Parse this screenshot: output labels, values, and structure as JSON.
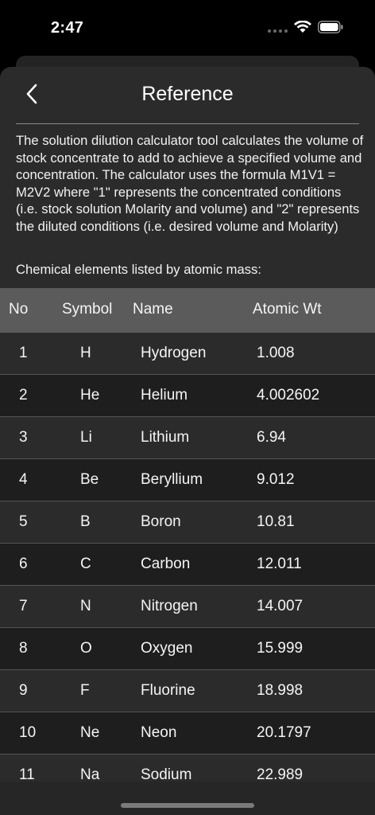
{
  "status_bar": {
    "time": "2:47"
  },
  "nav": {
    "title": "Reference"
  },
  "description": "The solution dilution calculator tool calculates the volume of stock concentrate to add to achieve a specified volume and concentration. The calculator uses the formula M1V1 = M2V2 where \"1\" represents the concentrated conditions (i.e. stock solution Molarity and volume) and \"2\" represents the diluted conditions (i.e. desired volume and Molarity)",
  "list_caption": "Chemical elements listed by atomic mass:",
  "table": {
    "headers": {
      "no": "No",
      "symbol": "Symbol",
      "name": "Name",
      "weight": "Atomic Wt"
    },
    "rows": [
      {
        "no": "1",
        "symbol": "H",
        "name": "Hydrogen",
        "weight": "1.008"
      },
      {
        "no": "2",
        "symbol": "He",
        "name": "Helium",
        "weight": "4.002602"
      },
      {
        "no": "3",
        "symbol": "Li",
        "name": "Lithium",
        "weight": "6.94"
      },
      {
        "no": "4",
        "symbol": "Be",
        "name": "Beryllium",
        "weight": "9.012"
      },
      {
        "no": "5",
        "symbol": "B",
        "name": "Boron",
        "weight": "10.81"
      },
      {
        "no": "6",
        "symbol": "C",
        "name": "Carbon",
        "weight": "12.011"
      },
      {
        "no": "7",
        "symbol": "N",
        "name": "Nitrogen",
        "weight": "14.007"
      },
      {
        "no": "8",
        "symbol": "O",
        "name": "Oxygen",
        "weight": "15.999"
      },
      {
        "no": "9",
        "symbol": "F",
        "name": "Fluorine",
        "weight": "18.998"
      },
      {
        "no": "10",
        "symbol": "Ne",
        "name": "Neon",
        "weight": "20.1797"
      },
      {
        "no": "11",
        "symbol": "Na",
        "name": "Sodium",
        "weight": "22.989"
      }
    ]
  },
  "icons": {
    "back": "chevron-left-icon",
    "wifi": "wifi-icon",
    "battery": "battery-icon",
    "signal": "cellular-signal-icon"
  },
  "colors": {
    "background": "#000000",
    "sheet": "#2b2b2b",
    "header_row": "#5b5b5b",
    "alt_row": "#1e1e1e"
  }
}
